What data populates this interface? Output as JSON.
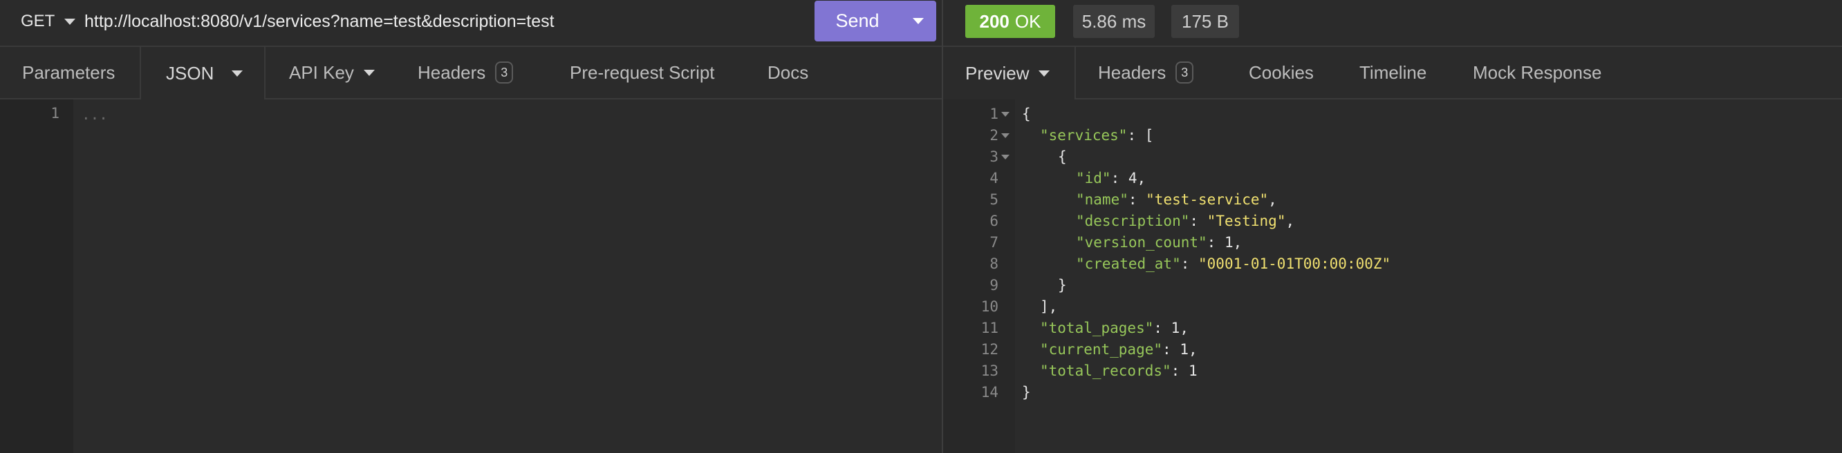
{
  "request": {
    "method": "GET",
    "url": "http://localhost:8080/v1/services?name=test&description=test",
    "send_label": "Send",
    "tabs": [
      {
        "label": "Parameters"
      },
      {
        "label": "JSON"
      },
      {
        "label": "API Key"
      },
      {
        "label": "Headers",
        "badge": "3"
      },
      {
        "label": "Pre-request Script"
      },
      {
        "label": "Docs"
      }
    ],
    "editor": {
      "line": "1",
      "placeholder": "..."
    }
  },
  "response": {
    "status_code": "200",
    "status_text": "OK",
    "time": "5.86 ms",
    "size": "175 B",
    "tabs": [
      {
        "label": "Preview"
      },
      {
        "label": "Headers",
        "badge": "3"
      },
      {
        "label": "Cookies"
      },
      {
        "label": "Timeline"
      },
      {
        "label": "Mock Response"
      }
    ],
    "body_lines": [
      {
        "n": "1",
        "indent": 0,
        "fold": true,
        "tokens": [
          [
            "p",
            "{"
          ]
        ]
      },
      {
        "n": "2",
        "indent": 1,
        "fold": true,
        "tokens": [
          [
            "k",
            "\"services\""
          ],
          [
            "p",
            ": ["
          ]
        ]
      },
      {
        "n": "3",
        "indent": 2,
        "fold": true,
        "tokens": [
          [
            "p",
            "{"
          ]
        ]
      },
      {
        "n": "4",
        "indent": 3,
        "fold": false,
        "tokens": [
          [
            "k",
            "\"id\""
          ],
          [
            "p",
            ": "
          ],
          [
            "n",
            "4"
          ],
          [
            "p",
            ","
          ]
        ]
      },
      {
        "n": "5",
        "indent": 3,
        "fold": false,
        "tokens": [
          [
            "k",
            "\"name\""
          ],
          [
            "p",
            ": "
          ],
          [
            "s",
            "\"test-service\""
          ],
          [
            "p",
            ","
          ]
        ]
      },
      {
        "n": "6",
        "indent": 3,
        "fold": false,
        "tokens": [
          [
            "k",
            "\"description\""
          ],
          [
            "p",
            ": "
          ],
          [
            "s",
            "\"Testing\""
          ],
          [
            "p",
            ","
          ]
        ]
      },
      {
        "n": "7",
        "indent": 3,
        "fold": false,
        "tokens": [
          [
            "k",
            "\"version_count\""
          ],
          [
            "p",
            ": "
          ],
          [
            "n",
            "1"
          ],
          [
            "p",
            ","
          ]
        ]
      },
      {
        "n": "8",
        "indent": 3,
        "fold": false,
        "tokens": [
          [
            "k",
            "\"created_at\""
          ],
          [
            "p",
            ": "
          ],
          [
            "s",
            "\"0001-01-01T00:00:00Z\""
          ]
        ]
      },
      {
        "n": "9",
        "indent": 2,
        "fold": false,
        "tokens": [
          [
            "p",
            "}"
          ]
        ]
      },
      {
        "n": "10",
        "indent": 1,
        "fold": false,
        "tokens": [
          [
            "p",
            "],"
          ]
        ]
      },
      {
        "n": "11",
        "indent": 1,
        "fold": false,
        "tokens": [
          [
            "k",
            "\"total_pages\""
          ],
          [
            "p",
            ": "
          ],
          [
            "n",
            "1"
          ],
          [
            "p",
            ","
          ]
        ]
      },
      {
        "n": "12",
        "indent": 1,
        "fold": false,
        "tokens": [
          [
            "k",
            "\"current_page\""
          ],
          [
            "p",
            ": "
          ],
          [
            "n",
            "1"
          ],
          [
            "p",
            ","
          ]
        ]
      },
      {
        "n": "13",
        "indent": 1,
        "fold": false,
        "tokens": [
          [
            "k",
            "\"total_records\""
          ],
          [
            "p",
            ": "
          ],
          [
            "n",
            "1"
          ]
        ]
      },
      {
        "n": "14",
        "indent": 0,
        "fold": false,
        "tokens": [
          [
            "p",
            "}"
          ]
        ]
      }
    ]
  },
  "colors": {
    "send": "#8175d3",
    "status_ok": "#6fb33a",
    "json_key": "#97c75a",
    "json_string": "#f0e070"
  }
}
